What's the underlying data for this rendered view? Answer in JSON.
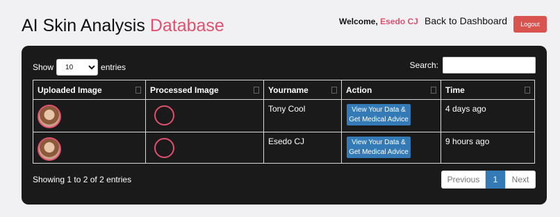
{
  "header": {
    "title_main": "AI Skin Analysis",
    "title_accent": "Database",
    "welcome_label": "Welcome,",
    "username": "Esedo CJ",
    "back_link": "Back to Dashboard",
    "logout_label": "Logout"
  },
  "table_controls": {
    "show_label": "Show",
    "entries_label": "entries",
    "page_length": "10",
    "search_label": "Search:",
    "search_value": ""
  },
  "columns": [
    "Uploaded Image",
    "Processed Image",
    "Yourname",
    "Action",
    "Time"
  ],
  "rows": [
    {
      "name": "Tony Cool",
      "action": "View Your Data & Get Medical Advice",
      "time": "4 days ago"
    },
    {
      "name": "Esedo CJ",
      "action": "View Your Data & Get Medical Advice",
      "time": "9 hours ago"
    }
  ],
  "footer": {
    "info": "Showing 1 to 2 of 2 entries",
    "prev_label": "Previous",
    "current_page": "1",
    "next_label": "Next"
  },
  "colors": {
    "accent": "#e0506f",
    "panel": "#1a1a1a",
    "primary": "#337ab7",
    "logout": "#d9534f"
  }
}
